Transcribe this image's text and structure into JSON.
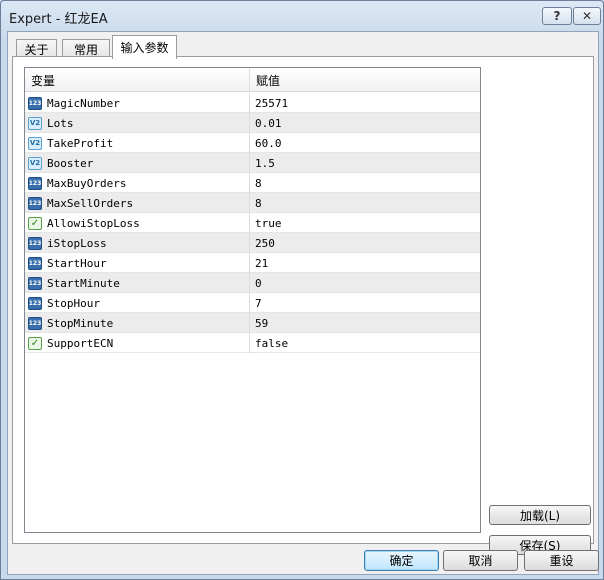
{
  "window": {
    "title": "Expert - 红龙EA",
    "help_label": "?",
    "close_label": "✕"
  },
  "tabs": [
    {
      "label": "关于"
    },
    {
      "label": "常用"
    },
    {
      "label": "输入参数"
    }
  ],
  "grid": {
    "header_variable": "变量",
    "header_value": "赋值",
    "rows": [
      {
        "icon": "123",
        "type": "int",
        "name": "MagicNumber",
        "value": "25571"
      },
      {
        "icon": "V2",
        "type": "double",
        "name": "Lots",
        "value": "0.01"
      },
      {
        "icon": "V2",
        "type": "double",
        "name": "TakeProfit",
        "value": "60.0"
      },
      {
        "icon": "V2",
        "type": "double",
        "name": "Booster",
        "value": "1.5"
      },
      {
        "icon": "123",
        "type": "int",
        "name": "MaxBuyOrders",
        "value": "8"
      },
      {
        "icon": "123",
        "type": "int",
        "name": "MaxSellOrders",
        "value": "8"
      },
      {
        "icon": "✓",
        "type": "bool",
        "name": "AllowiStopLoss",
        "value": "true"
      },
      {
        "icon": "123",
        "type": "int",
        "name": "iStopLoss",
        "value": "250"
      },
      {
        "icon": "123",
        "type": "int",
        "name": "StartHour",
        "value": "21"
      },
      {
        "icon": "123",
        "type": "int",
        "name": "StartMinute",
        "value": "0"
      },
      {
        "icon": "123",
        "type": "int",
        "name": "StopHour",
        "value": "7"
      },
      {
        "icon": "123",
        "type": "int",
        "name": "StopMinute",
        "value": "59"
      },
      {
        "icon": "✓",
        "type": "bool",
        "name": "SupportECN",
        "value": "false"
      }
    ]
  },
  "side_buttons": {
    "load": "加载(L)",
    "save": "保存(S)"
  },
  "bottom_buttons": {
    "ok": "确定",
    "cancel": "取消",
    "reset": "重设"
  }
}
